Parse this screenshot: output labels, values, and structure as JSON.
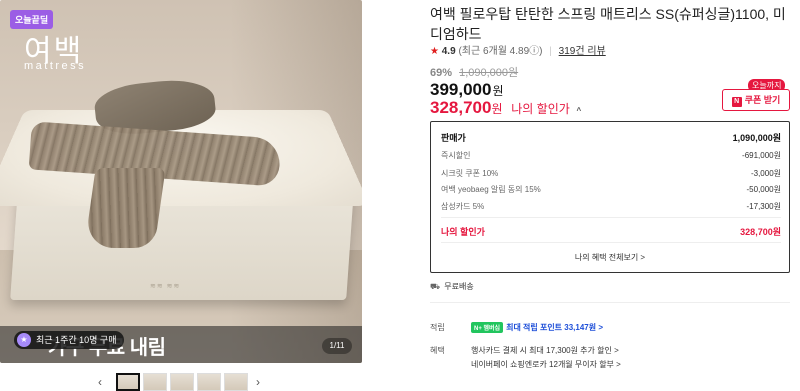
{
  "gallery": {
    "badge": "오늘끝딜",
    "brand_ko": "여백",
    "brand_en": "mattress",
    "promo_text": "가구 무료 내림",
    "toast_text": "최근 1주간 10명 구매",
    "counter": "1/11",
    "prev_icon": "‹",
    "next_icon": "›"
  },
  "product": {
    "title": "여백 필로우탑 탄탄한 스프링 매트리스 SS(슈퍼싱글)1100, 미디엄하드",
    "rating_star": "★",
    "rating_score": "4.9",
    "rating_sub": "(최근 6개월 4.89ⓘ)",
    "rating_sep": "|",
    "review_count": "319건 리뷰",
    "discount_pct": "69%",
    "original_price": "1,090,000원",
    "price": "399,000",
    "price_unit": "원",
    "my_price": "328,700",
    "my_price_unit": "원",
    "my_price_label": "나의 할인가",
    "my_price_caret": "^"
  },
  "coupon": {
    "tag": "오늘까지",
    "icon": "N",
    "label": "쿠폰 받기"
  },
  "breakdown": {
    "rows": [
      {
        "label": "판매가",
        "value": "1,090,000원"
      },
      {
        "label": "즉시할인",
        "value": "-691,000원"
      },
      {
        "label": "시크릿 쿠폰 10%",
        "value": "-3,000원"
      },
      {
        "label": "여백 yeobaeg 알림 동의 15%",
        "value": "-50,000원"
      },
      {
        "label": "삼성카드 5%",
        "value": "-17,300원"
      }
    ],
    "mine_label": "나의 할인가",
    "mine_value": "328,700원",
    "link": "나의 혜택 전체보기 >"
  },
  "shipping": {
    "icon": "⛟",
    "label": "무료배송"
  },
  "points": {
    "label": "적립",
    "npay": "N+ 멤버십",
    "text": "최대 적립 포인트 33,147원 >"
  },
  "benefits": {
    "label": "혜택",
    "lines": [
      "행사카드 결제 시 최대 17,300원 추가 할인 >",
      "네이버페이 쇼핑엔로카 12개월 무이자 할부 >"
    ]
  }
}
